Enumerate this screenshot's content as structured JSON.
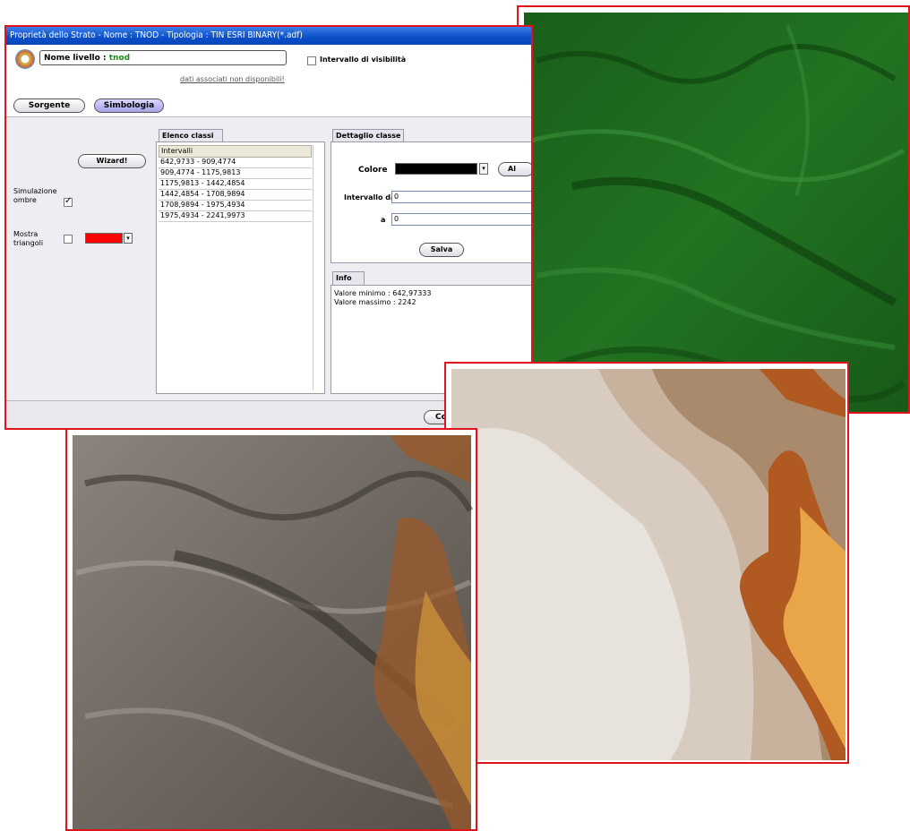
{
  "dialog": {
    "title": "Proprietà dello Strato - Nome : TNOD - Tipologia : TIN ESRI BINARY(*.adf)",
    "name_label": "Nome livello :",
    "name_value": "tnod",
    "visibility_label": "Intervallo di visibilità",
    "visibility_checked": false,
    "assoc_link": "dati associati non disponibili!",
    "tabs": [
      {
        "label": "Sorgente",
        "selected": false
      },
      {
        "label": "Simbologia",
        "selected": true
      }
    ],
    "wizard_label": "Wizard!",
    "shadow_label": "Simulazione ombre",
    "shadow_checked": true,
    "triangles_label": "Mostra triangoli",
    "triangles_checked": false,
    "triangles_color": "#ff0000",
    "classes": {
      "tab_label": "Elenco classi",
      "header": "Intervalli",
      "rows": [
        "642,9733 - 909,4774",
        "909,4774 - 1175,9813",
        "1175,9813 - 1442,4854",
        "1442,4854 - 1708,9894",
        "1708,9894 - 1975,4934",
        "1975,4934 - 2241,9973"
      ]
    },
    "detail": {
      "tab_label": "Dettaglio classe",
      "color_label": "Colore",
      "color_value": "#000000",
      "extra_button_label": "Al",
      "from_label": "Intervallo da",
      "from_value": "0",
      "to_label": "a",
      "to_value": "0",
      "save_label": "Salva"
    },
    "info": {
      "tab_label": "Info",
      "min_line": "Valore minimo : 642,97333",
      "max_line": "Valore massimo : 2242"
    },
    "bottom_button_label": "Co"
  },
  "images": [
    {
      "name": "green-hillshade",
      "dominant_color": "#1f6a1f"
    },
    {
      "name": "elevation-classes",
      "colors": [
        "#e8e2dc",
        "#d8cbbf",
        "#c8b29e",
        "#a98a6c",
        "#b05a22",
        "#e8a648"
      ]
    },
    {
      "name": "shaded-relief",
      "colors": [
        "#7a7570",
        "#5a534c",
        "#9a5a2a",
        "#c8903a"
      ]
    }
  ]
}
